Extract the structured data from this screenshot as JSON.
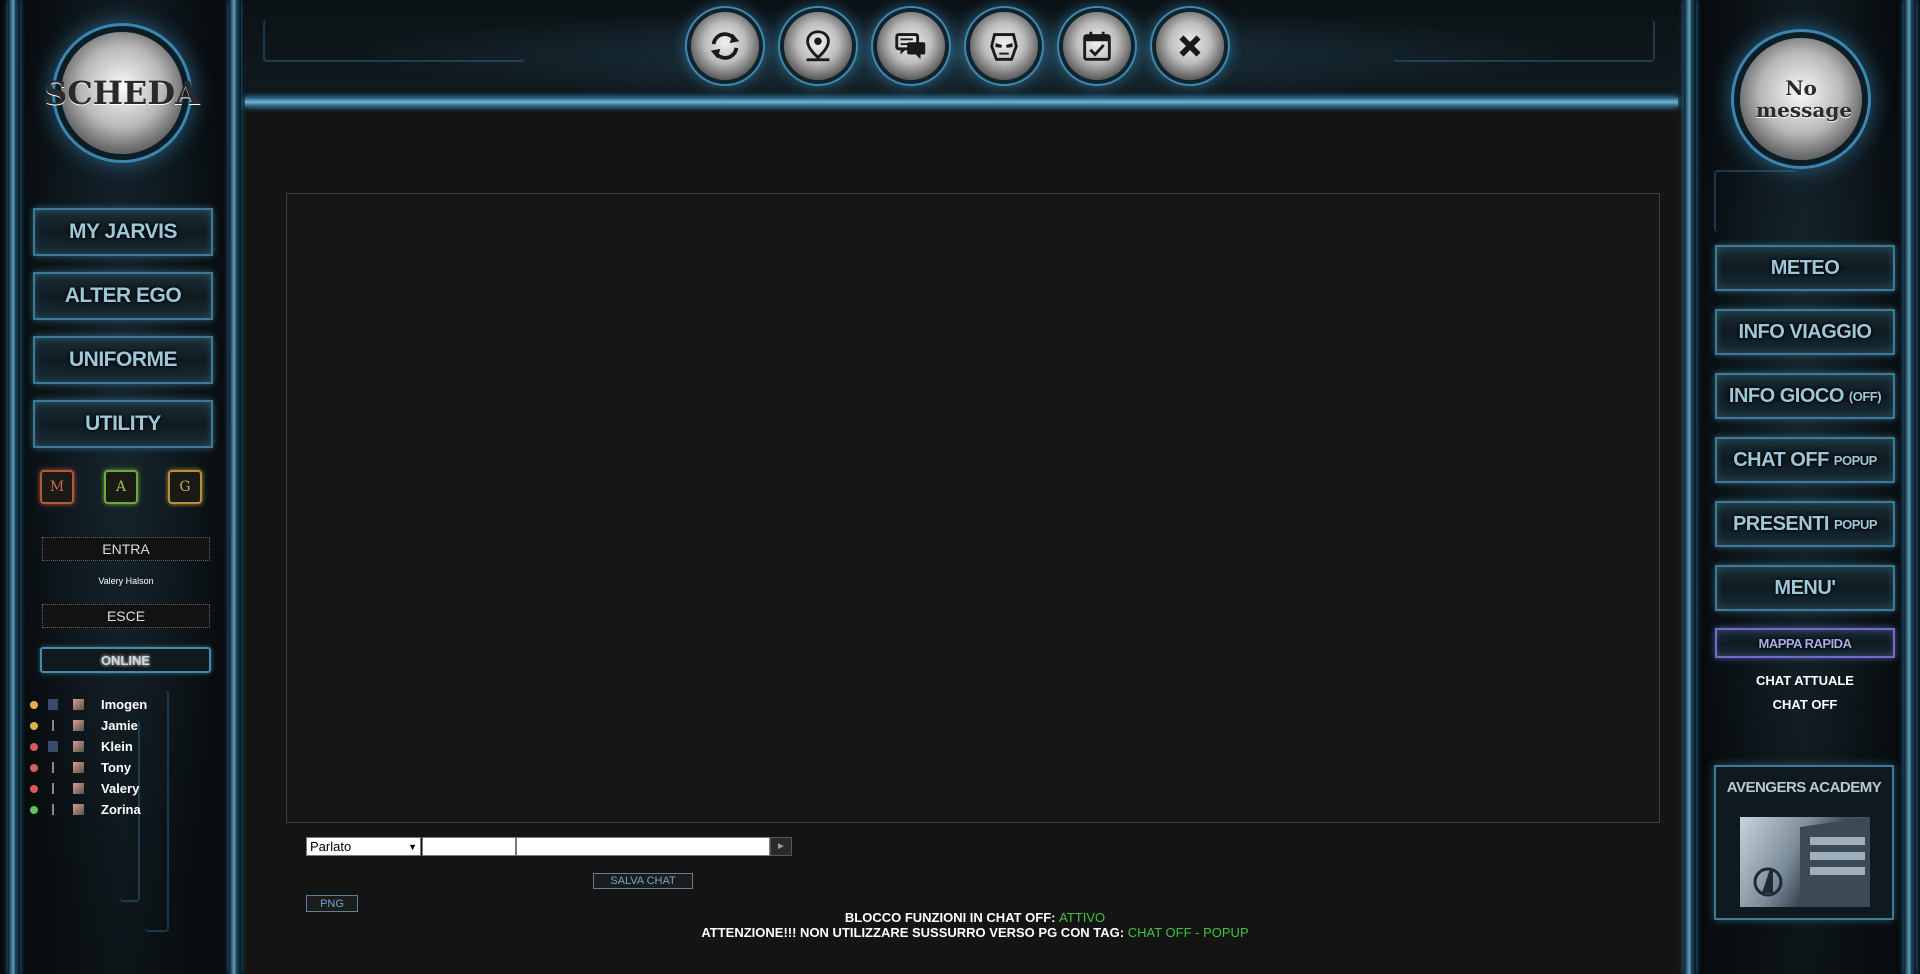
{
  "left": {
    "profile_label": "SCHEDA",
    "buttons": [
      "MY JARVIS",
      "ALTER EGO",
      "UNIFORME",
      "UTILITY"
    ],
    "mag": [
      "M",
      "A",
      "G"
    ],
    "enter_label": "ENTRA",
    "user_name": "Valery Halson",
    "exit_label": "ESCE",
    "online_label": "ONLINE",
    "online_users": [
      {
        "name": "Imogen",
        "status_color": "#e0b050"
      },
      {
        "name": "Jamie",
        "status_color": "#e0b050"
      },
      {
        "name": "Klein",
        "status_color": "#d65c5c"
      },
      {
        "name": "Tony",
        "status_color": "#d65c5c"
      },
      {
        "name": "Valery",
        "status_color": "#d65c5c"
      },
      {
        "name": "Zorina",
        "status_color": "#5cc45c"
      }
    ]
  },
  "top_icons": [
    "refresh-icon",
    "map-pin-icon",
    "chat-bubbles-icon",
    "iron-man-helmet-icon",
    "calendar-check-icon",
    "close-x-icon"
  ],
  "right": {
    "messages_label": "No message",
    "buttons": [
      {
        "main": "METEO",
        "sub": ""
      },
      {
        "main": "INFO VIAGGIO",
        "sub": ""
      },
      {
        "main": "INFO GIOCO",
        "sub": "(OFF)"
      },
      {
        "main": "CHAT OFF",
        "sub": "POPUP"
      },
      {
        "main": "PRESENTI",
        "sub": "POPUP"
      },
      {
        "main": "MENU'",
        "sub": ""
      }
    ],
    "quick_map": "MAPPA RAPIDA",
    "current_chat_label": "CHAT ATTUALE",
    "current_chat_value": "CHAT OFF",
    "academy_title": "AVENGERS ACADEMY"
  },
  "chat": {
    "type_selected": "Parlato",
    "save_label": "SALVA CHAT",
    "png_label": "PNG",
    "notice1_label": "BLOCCO FUNZIONI IN CHAT OFF:",
    "notice1_value": "ATTIVO",
    "notice2_label": "ATTENZIONE!!! NON UTILIZZARE SUSSURRO VERSO PG CON TAG:",
    "notice2_value": "CHAT OFF - POPUP"
  },
  "colors": {
    "accent": "#5fa0c4",
    "notice_green": "#3ec43e"
  }
}
